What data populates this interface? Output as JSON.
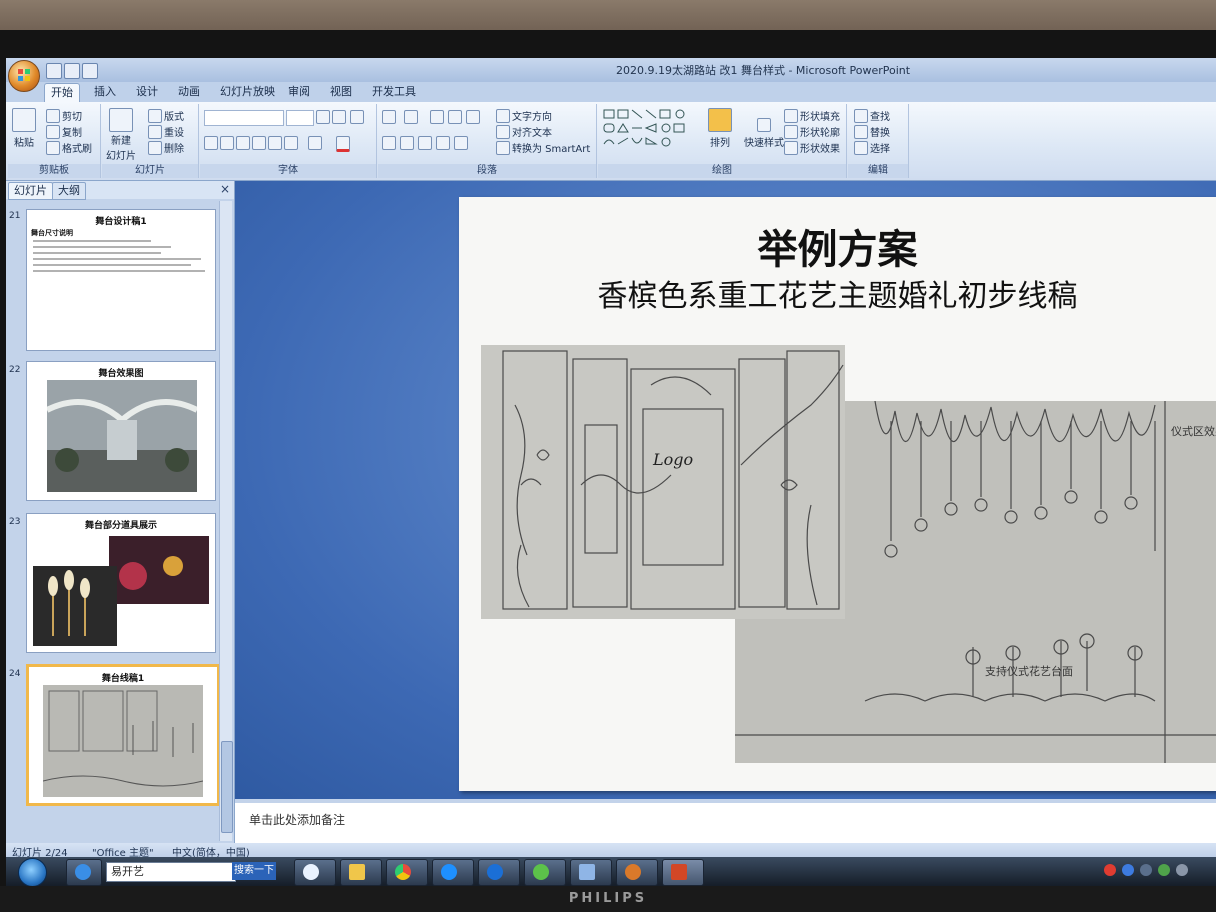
{
  "window": {
    "title": "2020.9.19太湖路站 改1 舞台样式 - Microsoft PowerPoint"
  },
  "ribbon": {
    "tabs": [
      "开始",
      "插入",
      "设计",
      "动画",
      "幻灯片放映",
      "审阅",
      "视图",
      "开发工具"
    ],
    "active_tab": "开始",
    "clipboard": {
      "paste": "粘贴",
      "cut": "剪切",
      "copy": "复制",
      "format_painter": "格式刷",
      "label": "剪贴板"
    },
    "slides": {
      "new_slide_1": "新建",
      "new_slide_2": "幻灯片",
      "layout": "版式",
      "reset": "重设",
      "delete": "删除",
      "label": "幻灯片"
    },
    "font": {
      "label": "字体"
    },
    "paragraph": {
      "text_direction": "文字方向",
      "align_text": "对齐文本",
      "smartart": "转换为 SmartArt",
      "label": "段落"
    },
    "drawing": {
      "arrange": "排列",
      "quick_styles": "快速样式",
      "shape_fill": "形状填充",
      "shape_outline": "形状轮廓",
      "shape_effects": "形状效果",
      "label": "绘图"
    },
    "editing": {
      "find": "查找",
      "replace": "替换",
      "select": "选择",
      "label": "编辑"
    }
  },
  "left_pane": {
    "tabs": [
      "幻灯片",
      "大纲"
    ],
    "close_glyph": "×",
    "thumbnails": [
      {
        "number": "21",
        "title": "舞台设计稿1",
        "caption": "舞台尺寸说明"
      },
      {
        "number": "22",
        "title": "舞台效果图"
      },
      {
        "number": "23",
        "title": "舞台部分道具展示"
      },
      {
        "number": "24",
        "title": "舞台线稿1",
        "selected": true
      }
    ]
  },
  "slide": {
    "title": "举例方案",
    "subtitle": "香槟色系重工花艺主题婚礼初步线稿",
    "sketch_logo_text": "Logo",
    "sketch_side_text": "仪式区效果",
    "sketch_mid_text": "支持仪式花艺台面"
  },
  "notes": {
    "placeholder": "单击此处添加备注"
  },
  "status": {
    "slide_info": "幻灯片 2/24",
    "theme": "\"Office 主题\"",
    "language": "中文(简体，中国)"
  },
  "taskbar": {
    "search_text": "易开艺",
    "search_button": "搜索一下"
  },
  "monitor": {
    "brand": "PHILIPS"
  },
  "colors": {
    "accent": "#3d69b4",
    "selection": "#f1b84a"
  }
}
